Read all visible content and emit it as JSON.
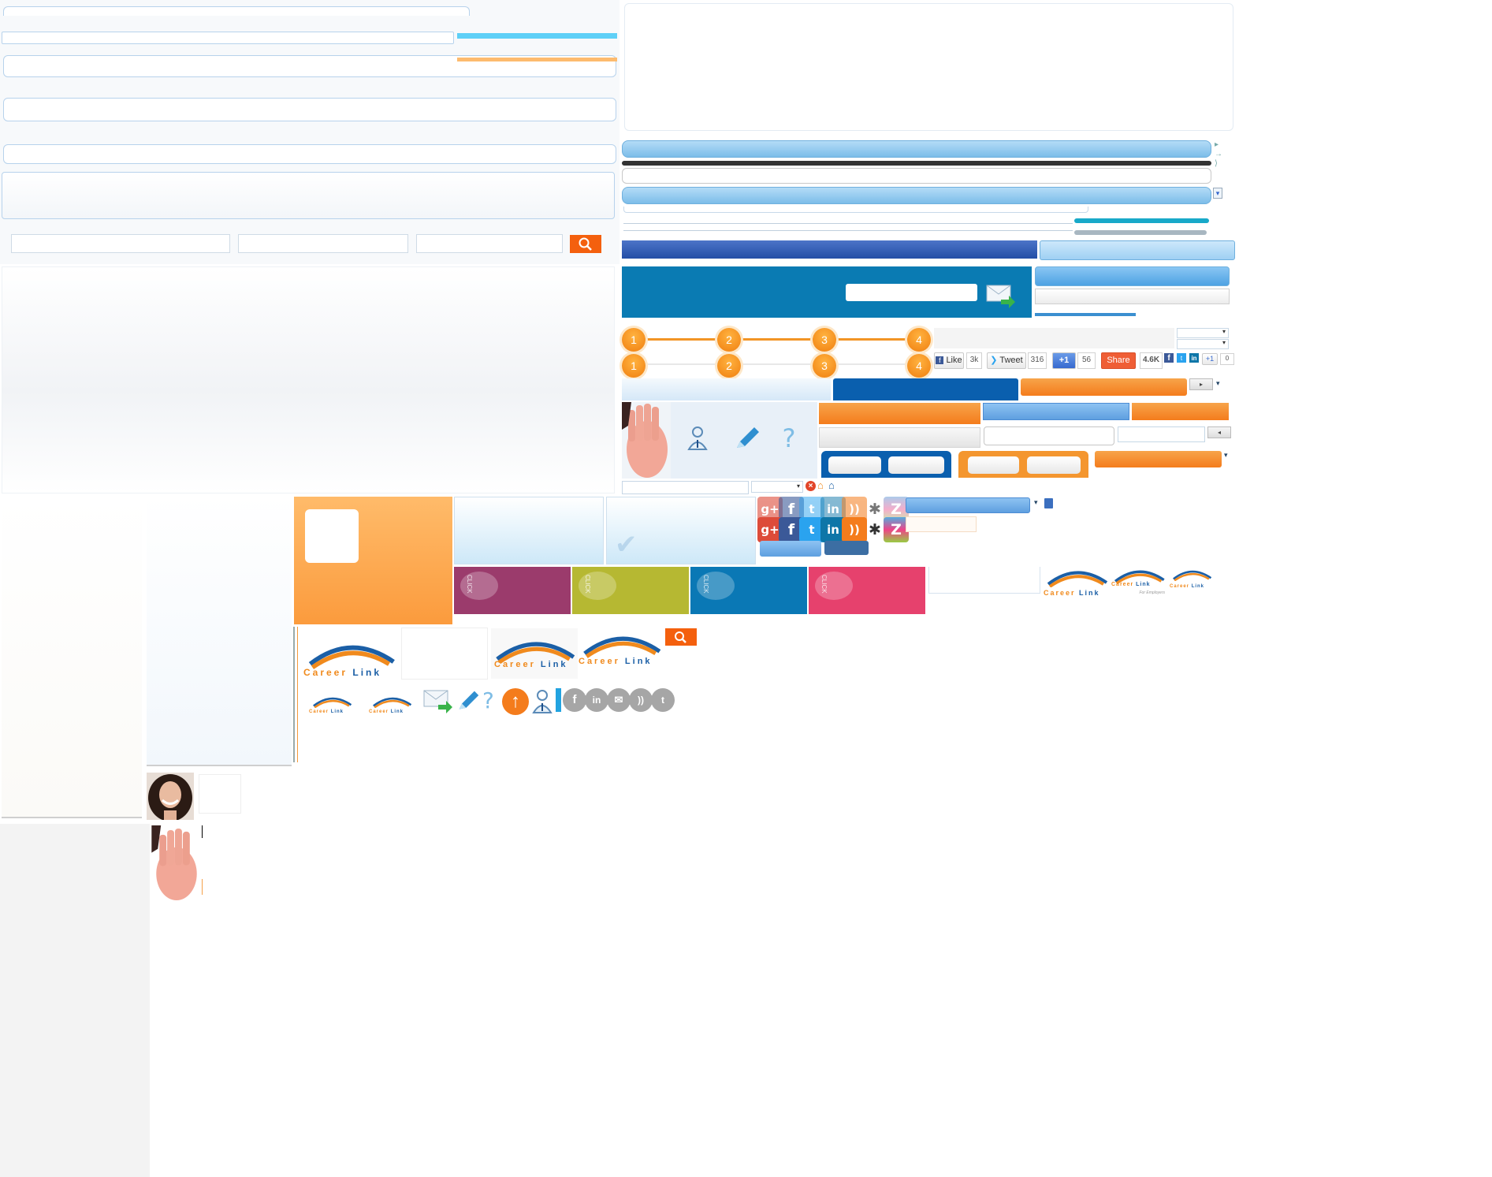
{
  "steps": {
    "top": [
      "1",
      "2",
      "3",
      "4"
    ],
    "bottom": [
      "1",
      "2",
      "3",
      "4"
    ]
  },
  "social_share": {
    "like": "Like",
    "like_count": "3k",
    "tweet": "Tweet",
    "tweet_count": "316",
    "plusone": "+1",
    "plusone_count": "56",
    "share": "Share",
    "share_count": "4.6K",
    "mini_plusone": "+1",
    "mini_count": "0"
  },
  "tiles": {
    "click_label": "CLICK",
    "colors": [
      "#9b3b6c",
      "#b6b832",
      "#0a78b5",
      "#e6416d"
    ]
  },
  "logo": {
    "word1": "Career",
    "word2": "Link",
    "tagline": "For Employers"
  },
  "icons": {
    "search": "search-icon",
    "mail": "mail-arrow-icon",
    "pencil": "pencil-icon",
    "help": "question-icon",
    "user": "user-icon",
    "up": "up-arrow-icon"
  },
  "colors": {
    "accent_orange": "#f47c1c",
    "accent_blue": "#0a7bb3",
    "navy": "#2b5fb4"
  }
}
